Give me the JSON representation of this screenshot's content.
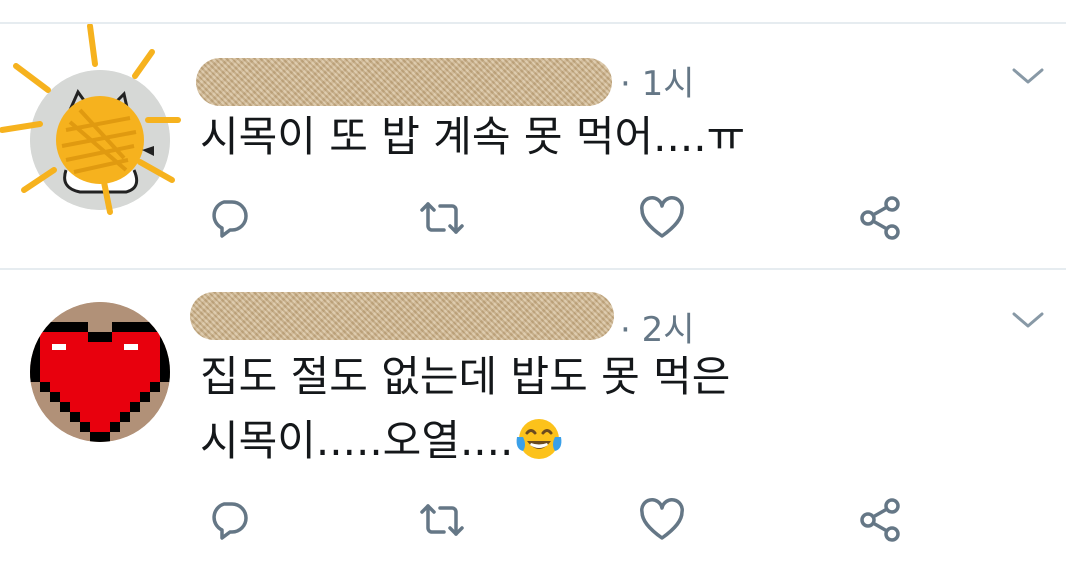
{
  "tweets": [
    {
      "time": "· 1시",
      "text_lines": [
        "시목이 또 밥 계속 못 먹어....ㅠ"
      ],
      "avatar": "sun-scribble-avatar"
    },
    {
      "time": "· 2시",
      "text_lines": [
        "집도 절도 없는데 밥도 못 먹은",
        "시목이.....오열...."
      ],
      "emoji": "face-with-tears-of-joy-emoji",
      "avatar": "pixel-heart-avatar"
    }
  ],
  "icons": {
    "reply": "reply-icon",
    "retweet": "retweet-icon",
    "like": "heart-icon",
    "share": "share-icon",
    "more": "chevron-down-icon"
  },
  "colors": {
    "text": "#14171a",
    "secondary": "#657786",
    "divider": "#e6ecf0",
    "censor_blur": "#d2b88f",
    "sun_yellow": "#f6b21e",
    "heart_red": "#e8000d"
  }
}
